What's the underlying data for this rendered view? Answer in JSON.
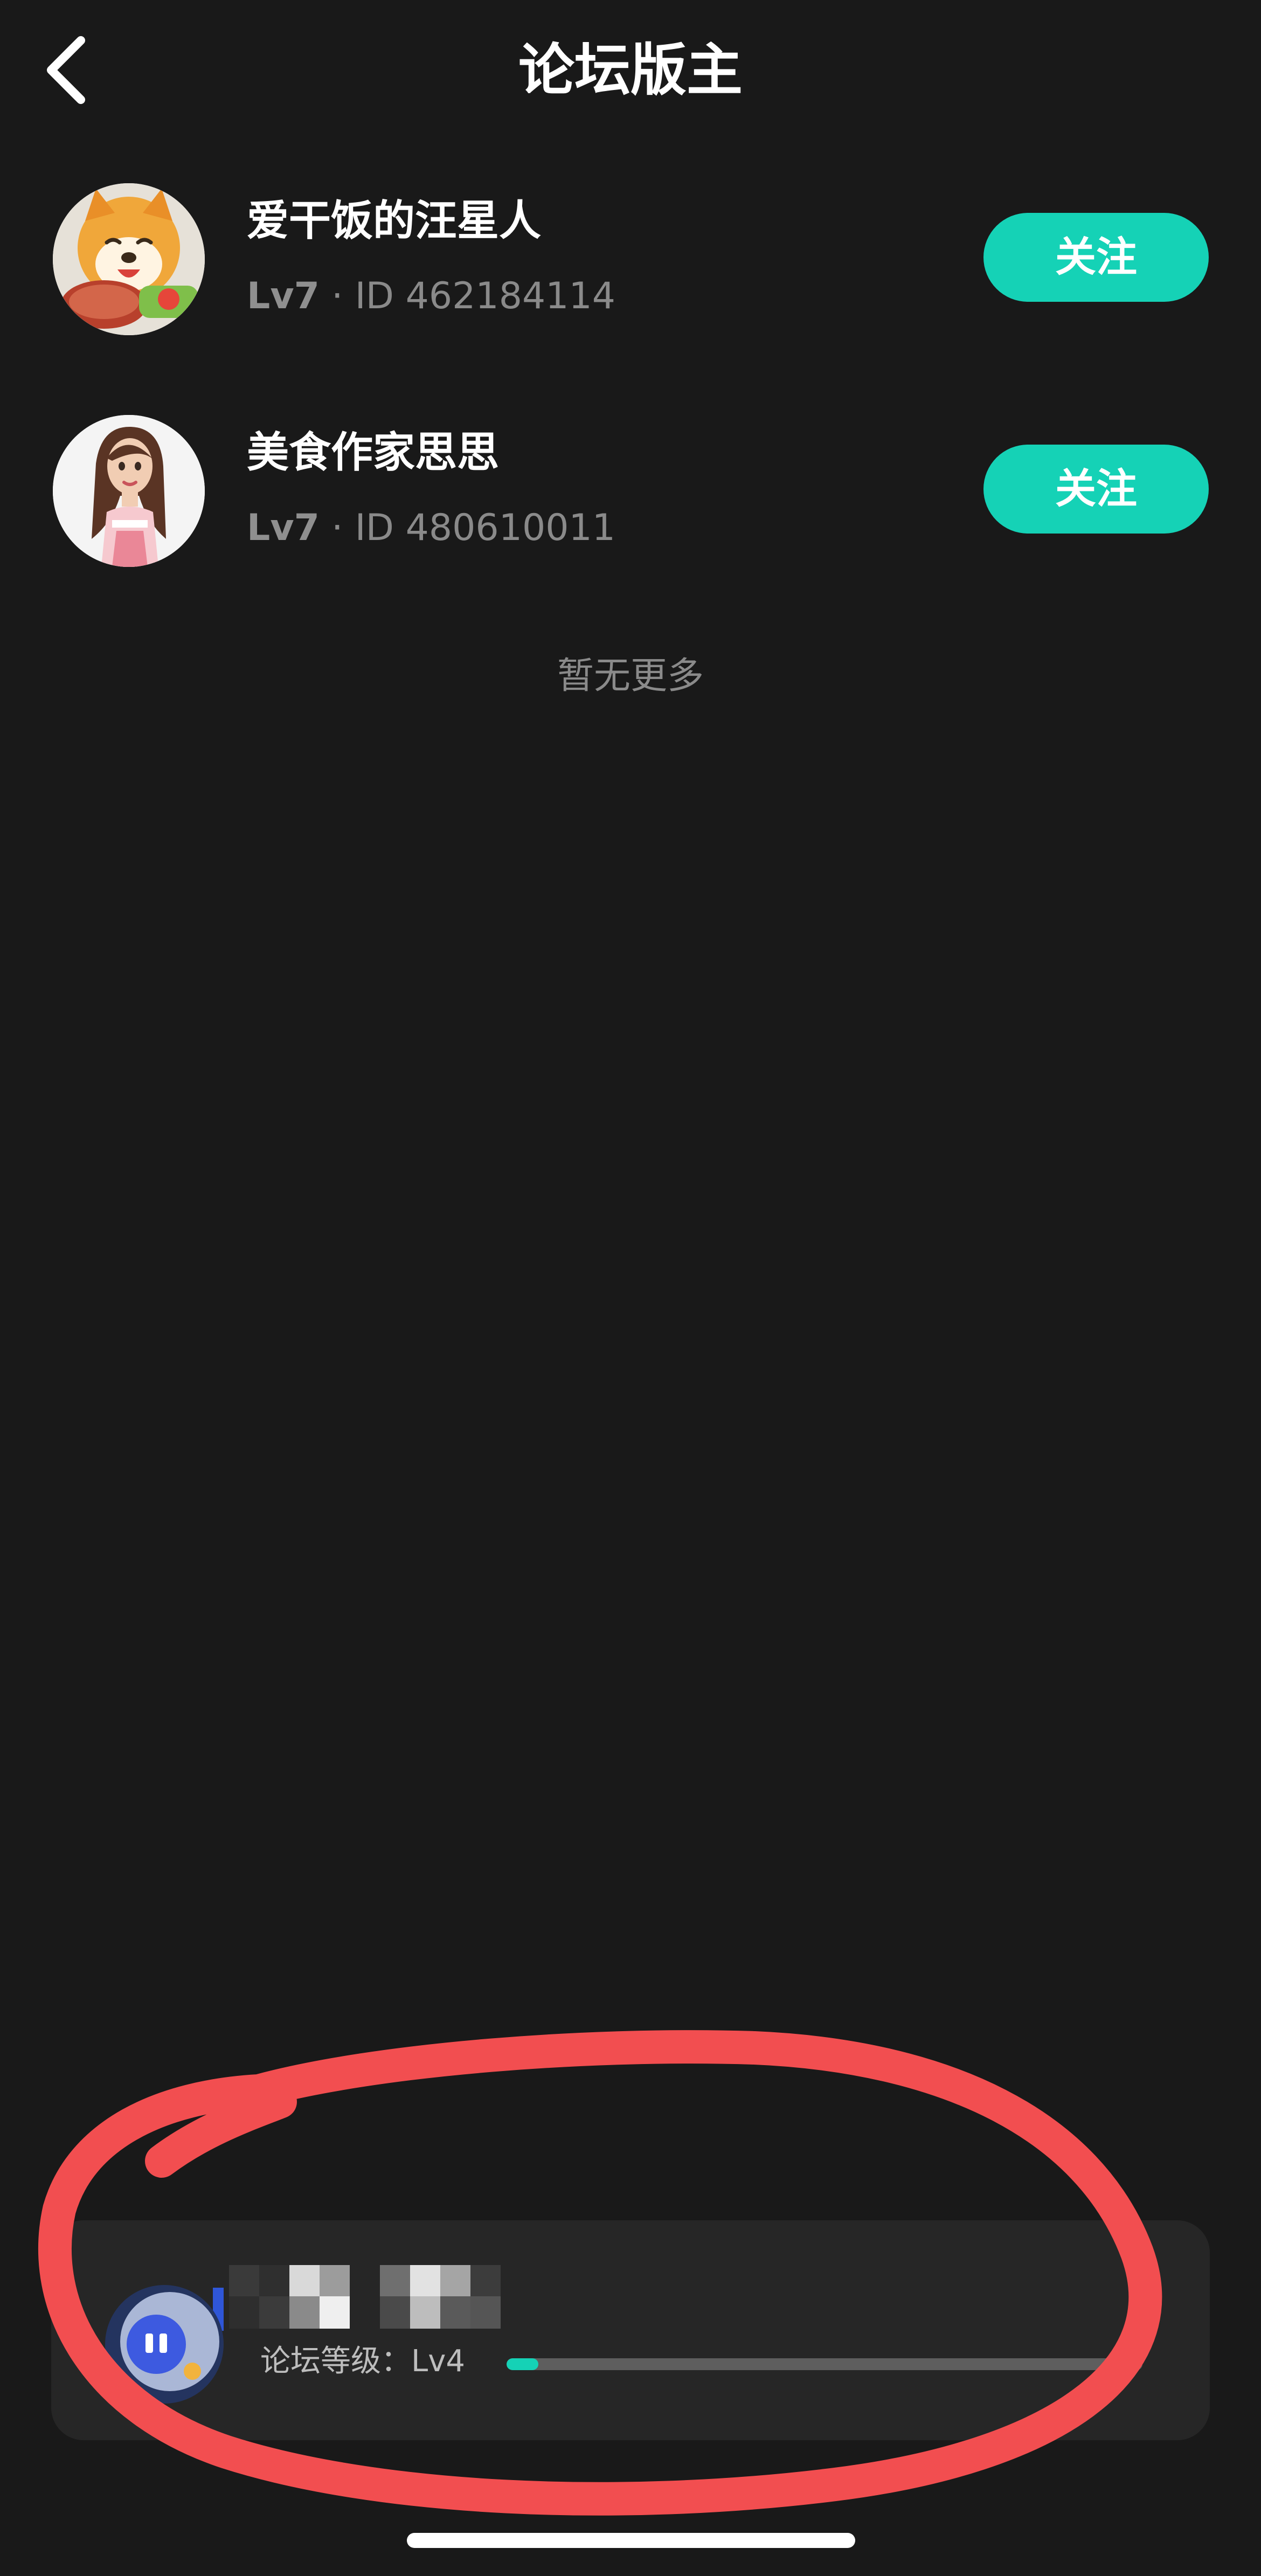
{
  "header": {
    "title": "论坛版主",
    "back_icon": "chevron-left-icon"
  },
  "moderators": [
    {
      "name": "爱干饭的汪星人",
      "level": "Lv7",
      "separator": "·",
      "id_text": "ID 462184114",
      "follow_label": "关注"
    },
    {
      "name": "美食作家思思",
      "level": "Lv7",
      "separator": "·",
      "id_text": "ID 480610011",
      "follow_label": "关注"
    }
  ],
  "list_footer": "暂无更多",
  "user_card": {
    "forum_level_label": "论坛等级：Lv4",
    "level_progress_fraction": 0.05
  },
  "colors": {
    "background": "#191919",
    "accent": "#15d2b6",
    "card": "#262626",
    "annotation": "#f24e50"
  }
}
